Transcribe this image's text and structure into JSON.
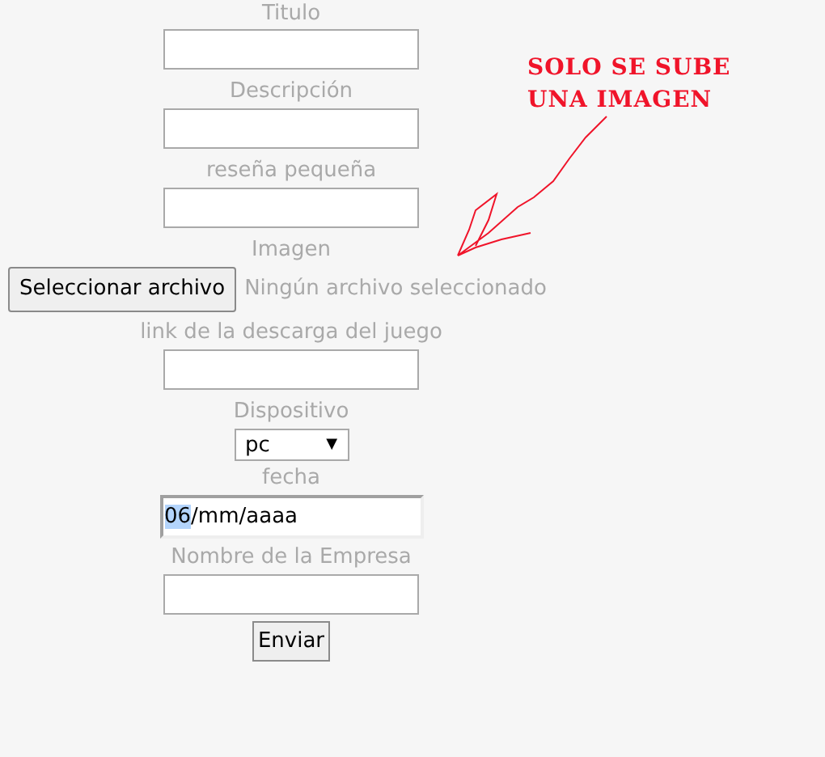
{
  "form": {
    "fields": [
      {
        "kind": "text",
        "label": "Titulo"
      },
      {
        "kind": "text",
        "label": "Descripción"
      },
      {
        "kind": "text",
        "label": "reseña pequeña"
      },
      {
        "kind": "file",
        "label": "Imagen",
        "button": "Seleccionar archivo",
        "status": "Ningún archivo seleccionado"
      },
      {
        "kind": "text",
        "label": "link de la descarga del juego"
      },
      {
        "kind": "select",
        "label": "Dispositivo",
        "value": "pc",
        "caret": "▼"
      },
      {
        "kind": "date",
        "label": "fecha",
        "value_parts": [
          {
            "text": "06",
            "selected": true
          },
          {
            "text": "/mm/aaaa",
            "selected": false
          }
        ]
      },
      {
        "kind": "text",
        "label": "Nombre de la Empresa"
      }
    ],
    "submit": "Enviar"
  },
  "annotation": {
    "lines": [
      "SOLO SE SUBE",
      "UNA IMAGEN"
    ]
  }
}
